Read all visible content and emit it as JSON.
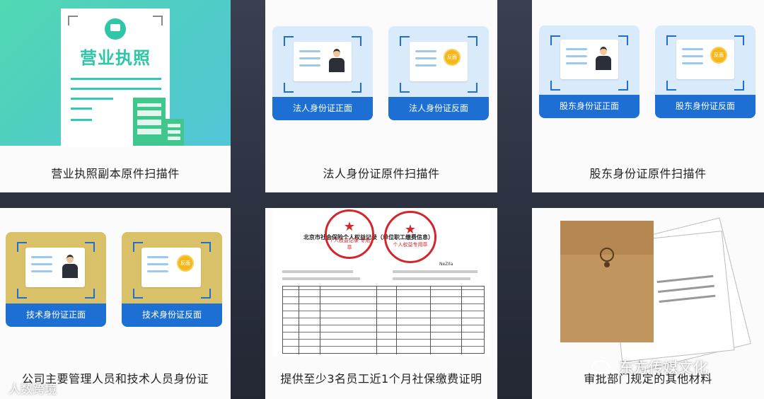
{
  "cards": [
    {
      "caption": "营业执照副本原件扫描件",
      "license_title": "营业执照"
    },
    {
      "caption": "法人身份证原件扫描件",
      "tiles": [
        "法人身份证正面",
        "法人身份证反面"
      ]
    },
    {
      "caption": "股东身份证原件扫描件",
      "tiles": [
        "股东身份证正面",
        "股东身份证反面"
      ]
    },
    {
      "caption": "公司主要管理人员和技术人员身份证",
      "tiles": [
        "技术身份证正面",
        "技术身份证反面"
      ]
    },
    {
      "caption": "提供至少3名员工近1个月社保缴费证明",
      "doc_title": "北京市社会保险个人权益记录（单位职工缴费信息）",
      "stamp1": "个人权益记录 专用章",
      "stamp2": "个人权益专用章",
      "nezila": "NeZIla"
    },
    {
      "caption": "审批部门规定的其他材料"
    }
  ],
  "badge_text": "反面",
  "watermarks": {
    "left": "人数跨境",
    "right": "东方传媒文化"
  },
  "colors": {
    "accent_blue": "#1d6fd3",
    "license_green": "#2fc6a8",
    "stamp_red": "#d3262c"
  }
}
